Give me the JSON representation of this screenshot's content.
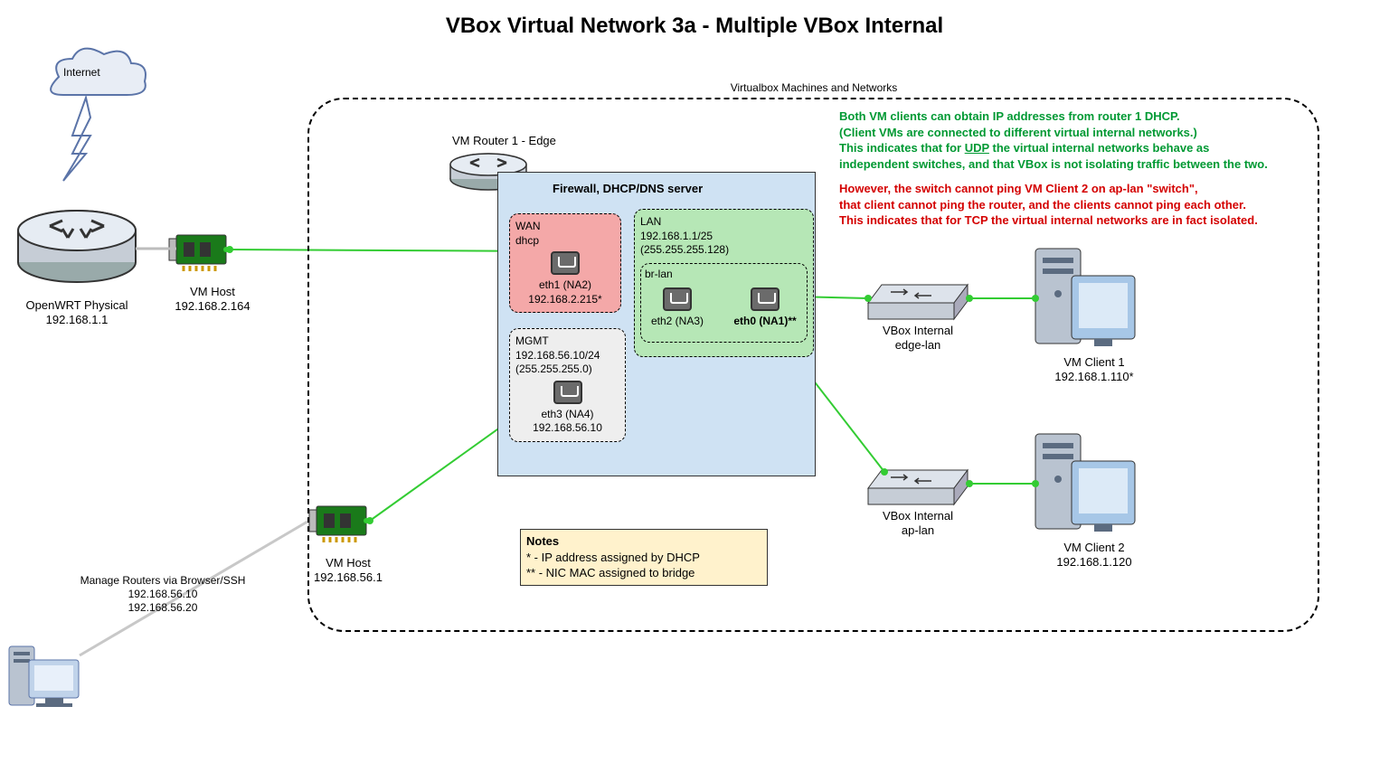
{
  "title": "VBox Virtual Network 3a - Multiple VBox Internal",
  "internet": {
    "label": "Internet"
  },
  "openwrt": {
    "name": "OpenWRT Physical",
    "ip": "192.168.1.1"
  },
  "vm_host_top": {
    "name": "VM Host",
    "ip": "192.168.2.164"
  },
  "vm_host_bottom": {
    "name": "VM Host",
    "ip": "192.168.56.1"
  },
  "mgmt_pc": {
    "title": "Manage Routers via Browser/SSH",
    "ip1": "192.168.56.10",
    "ip2": "192.168.56.20"
  },
  "vbox_container_label": "Virtualbox Machines and Networks",
  "router1": {
    "title": "VM Router 1 - Edge",
    "services": "Firewall, DHCP/DNS server",
    "wan": {
      "name": "WAN",
      "mode": "dhcp",
      "iface": "eth1 (NA2)",
      "ip": "192.168.2.215*"
    },
    "lan": {
      "name": "LAN",
      "cidr": "192.168.1.1/25",
      "mask": "(255.255.255.128)",
      "br": "br-lan",
      "if1": "eth2 (NA3)",
      "if2": "eth0 (NA1)**"
    },
    "mgmt": {
      "name": "MGMT",
      "cidr": "192.168.56.10/24",
      "mask": "(255.255.255.0)",
      "iface": "eth3 (NA4)",
      "ip": "192.168.56.10"
    }
  },
  "switch1": {
    "name": "VBox Internal",
    "net": "edge-lan"
  },
  "switch2": {
    "name": "VBox Internal",
    "net": "ap-lan"
  },
  "client1": {
    "name": "VM Client 1",
    "ip": "192.168.1.110*"
  },
  "client2": {
    "name": "VM Client 2",
    "ip": "192.168.1.120"
  },
  "commentary": {
    "l1": "Both VM clients can obtain IP addresses from router 1 DHCP.",
    "l2": "(Client VMs are connected to different virtual internal networks.)",
    "l3a": "This indicates that for ",
    "l3b": "UDP",
    "l3c": " the virtual internal networks behave as",
    "l4": "independent switches, and that VBox is not isolating traffic between the two.",
    "l5": "However, the switch cannot ping  VM Client 2 on ap-lan \"switch\",",
    "l6": "that client  cannot ping the router, and the clients cannot ping each other.",
    "l7": "This indicates that for TCP the virtual internal networks are in fact isolated."
  },
  "notes": {
    "title": "Notes",
    "n1": "* - IP address assigned by DHCP",
    "n2": "** - NIC MAC assigned to bridge"
  }
}
